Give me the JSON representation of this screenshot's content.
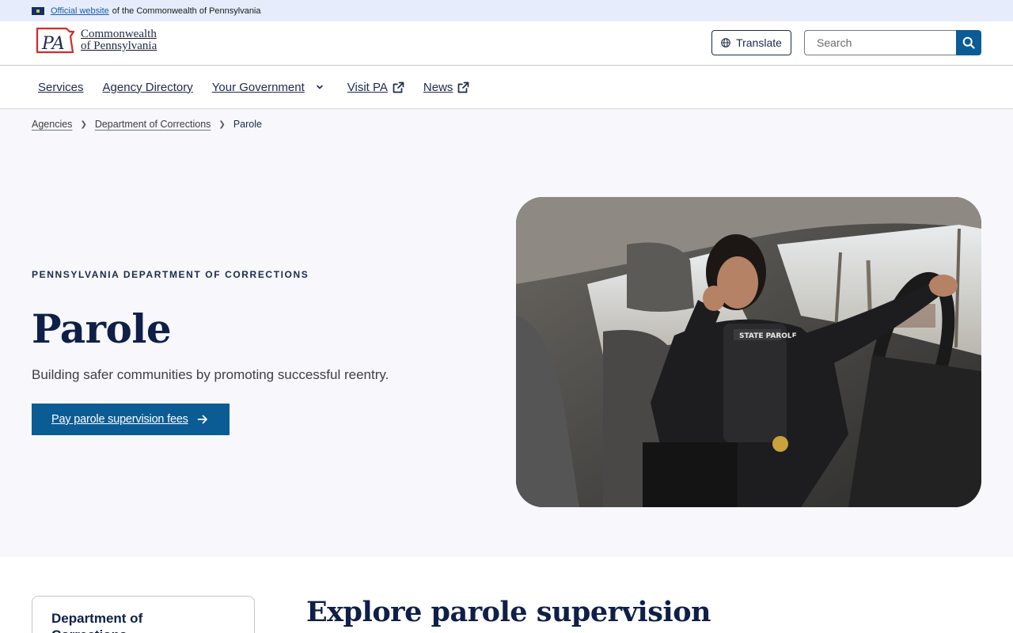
{
  "gov_banner": {
    "link_text": "Official website",
    "text": "of the Commonwealth of Pennsylvania",
    "flag_color": "#10306a"
  },
  "header": {
    "logo_mark": "PA",
    "logo_line1": "Commonwealth",
    "logo_line2": "of Pennsylvania",
    "translate_label": "Translate",
    "search_placeholder": "Search",
    "accent_color": "#0b5c94"
  },
  "nav": {
    "items": [
      {
        "label": "Services",
        "icon": ""
      },
      {
        "label": "Agency Directory",
        "icon": ""
      },
      {
        "label": "Your Government",
        "icon": "chevron-down-icon"
      },
      {
        "label": "Visit PA",
        "icon": "external-link-icon"
      },
      {
        "label": "News",
        "icon": "external-link-icon"
      }
    ]
  },
  "breadcrumb": {
    "items": [
      "Agencies",
      "Department of Corrections",
      "Parole"
    ]
  },
  "hero": {
    "eyebrow": "PENNSYLVANIA DEPARTMENT OF CORRECTIONS",
    "title": "Parole",
    "subtitle": "Building safer communities by promoting successful reentry.",
    "cta_label": "Pay parole supervision fees",
    "photo_caption_vest": "STATE PAROLE"
  },
  "lower": {
    "side_card_title": "Department of Corrections",
    "section_title": "Explore parole supervision"
  }
}
